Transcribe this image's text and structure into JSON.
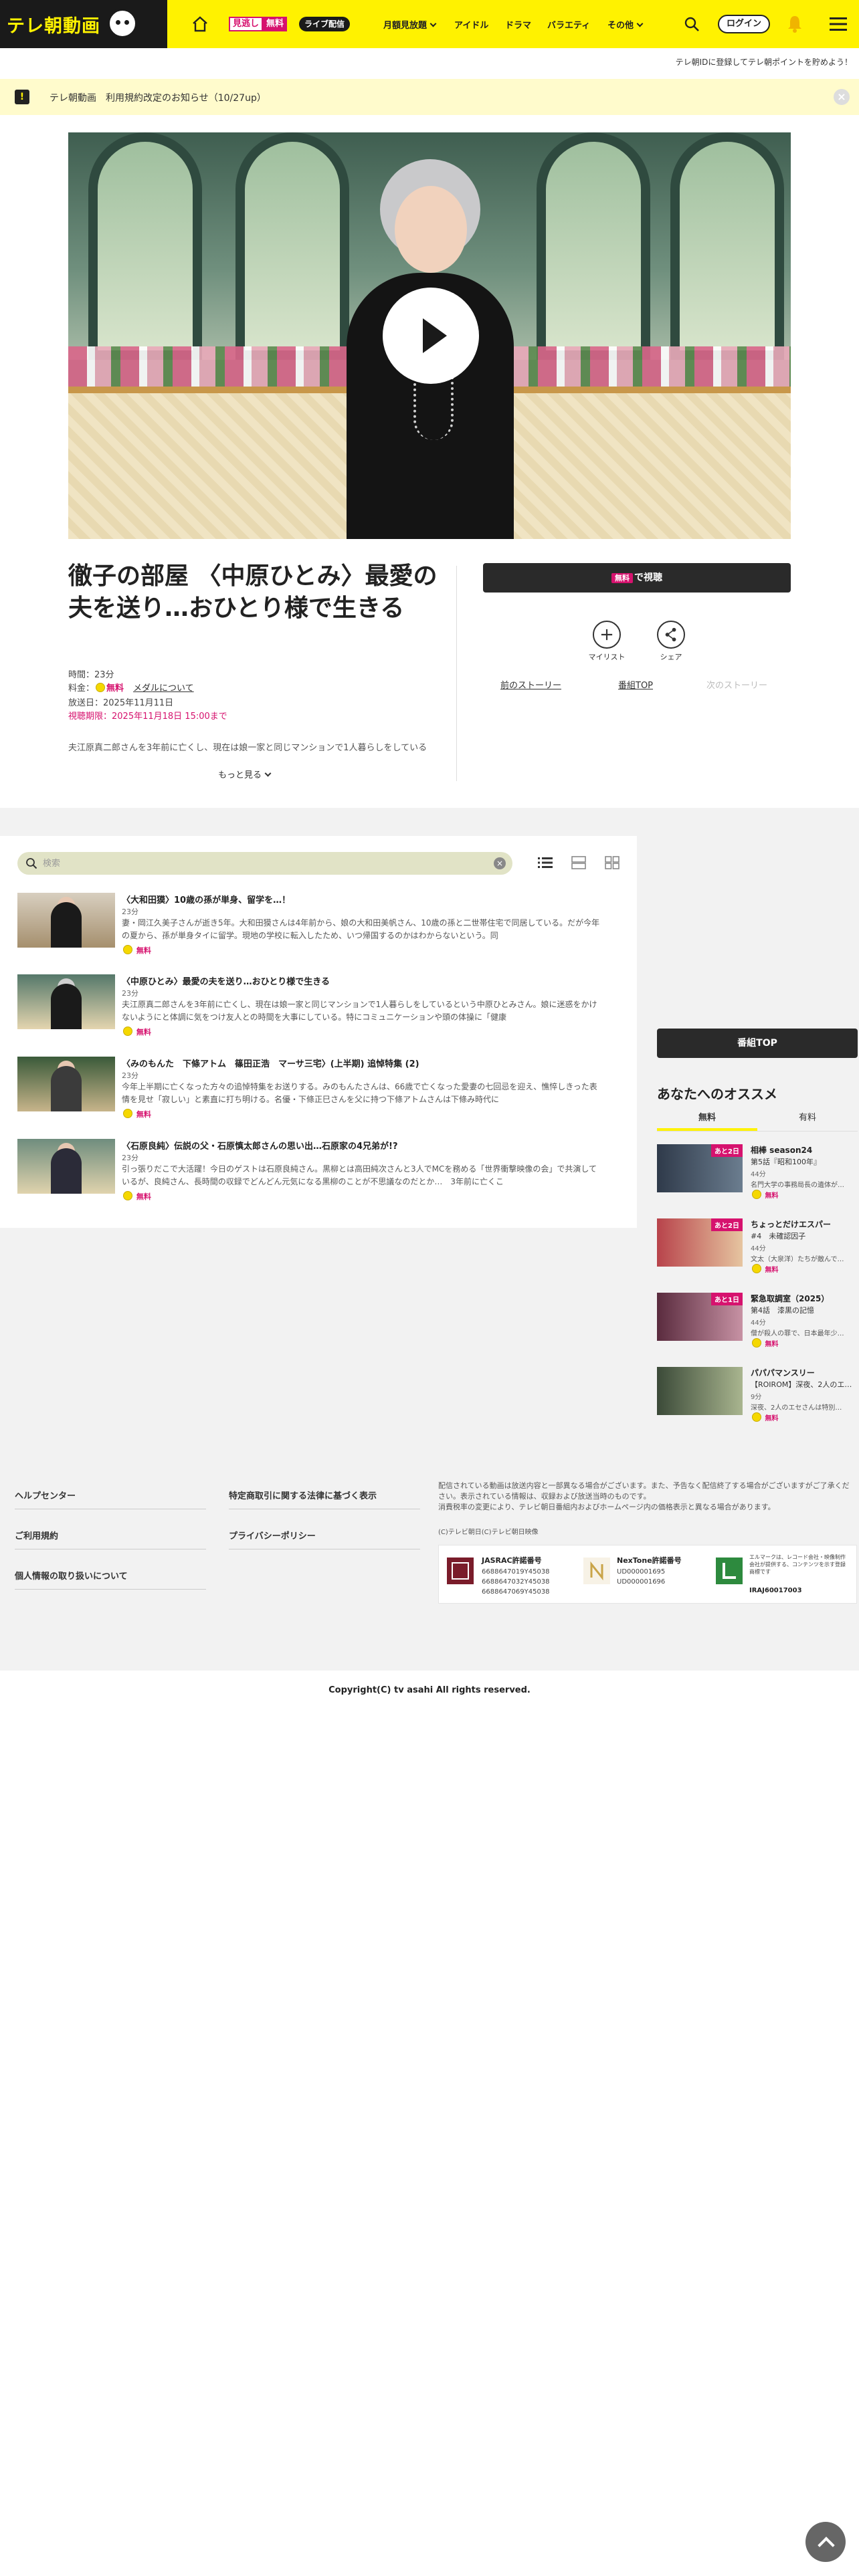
{
  "header": {
    "logo": "テレ朝動画",
    "badge_mitsu": "見逃し",
    "badge_mitsu_free": "無料",
    "badge_live": "ライブ配信",
    "nav": [
      "月額見放題",
      "アイドル",
      "ドラマ",
      "バラエティ",
      "その他"
    ],
    "login": "ログイン",
    "promo": "テレ朝IDに登録してテレ朝ポイントを貯めよう！"
  },
  "notice": {
    "text": "テレ朝動画　利用規約改定のお知らせ（10/27up）",
    "close": "×"
  },
  "episode": {
    "title": "徹子の部屋 〈中原ひとみ〉最愛の夫を送り…おひとり様で生きる",
    "duration": "時間：23分",
    "fee_label": "料金：",
    "fee_free": "無料",
    "medal_link": "メダルについて",
    "air_date": "放送日：2025年11月11日",
    "deadline": "視聴期限：2025年11月18日 15:00まで",
    "description": "夫江原真二郎さんを3年前に亡くし、現在は娘一家と同じマンションで1人暮らしをしている",
    "more": "もっと見る"
  },
  "actions": {
    "watch_tag": "無料",
    "watch_label": "で視聴",
    "mylist": "マイリスト",
    "share": "シェア",
    "prev": "前のストーリー",
    "program_top": "番組TOP",
    "next": "次のストーリー"
  },
  "list": {
    "search_placeholder": "検索",
    "clear": "×",
    "items": [
      {
        "title": "〈大和田獏〉10歳の孫が単身、留学を…！",
        "duration": "23分",
        "desc": "妻・岡江久美子さんが逝き5年。大和田獏さんは4年前から、娘の大和田美帆さん、10歳の孫と二世帯住宅で同居している。だが今年の夏から、孫が単身タイに留学。現地の学校に転入したため、いつ帰国するのかはわからないという。同",
        "free": "無料"
      },
      {
        "title": "〈中原ひとみ〉最愛の夫を送り…おひとり様で生きる",
        "duration": "23分",
        "desc": "夫江原真二郎さんを3年前に亡くし、現在は娘一家と同じマンションで1人暮らしをしているという中原ひとみさん。娘に迷惑をかけないようにと体調に気をつけ友人との時間を大事にしている。特にコミュニケーションや頭の体操に「健康",
        "free": "無料"
      },
      {
        "title": "〈みのもんた　下條アトム　篠田正浩　マーサ三宅〉(上半期) 追悼特集 (2)",
        "duration": "23分",
        "desc": "今年上半期に亡くなった方々の追悼特集をお送りする。みのもんたさんは、66歳で亡くなった愛妻の七回忌を迎え、憔悴しきった表情を見せ「寂しい」と素直に打ち明ける。名優・下條正巳さんを父に持つ下條アトムさんは下條み時代に",
        "free": "無料"
      },
      {
        "title": "〈石原良純〉伝説の父・石原慎太郎さんの思い出…石原家の4兄弟が!?",
        "duration": "23分",
        "desc": "引っ張りだこで大活躍！今日のゲストは石原良純さん。黒柳とは高田純次さんと3人でMCを務める「世界衝撃映像の会」で共演しているが、良純さん、長時間の収録でどんどん元気になる黒柳のことが不思議なのだとか…　3年前に亡くこ",
        "free": "無料"
      }
    ]
  },
  "sidebar": {
    "program_top": "番組TOP",
    "title": "あなたへのオススメ",
    "tabs": [
      "無料",
      "有料"
    ],
    "items": [
      {
        "badge": "あと2日",
        "title": "相棒 season24",
        "sub": "第5話『昭和100年』",
        "dur": "44分",
        "desc": "名門大学の事務局長の遺体が…",
        "free": "無料"
      },
      {
        "badge": "あと2日",
        "title": "ちょっとだけエスパー",
        "sub": "#4　未確認因子",
        "dur": "44分",
        "desc": "文太（大泉洋）たちが敵んで…",
        "free": "無料"
      },
      {
        "badge": "あと1日",
        "title": "緊急取調室（2025）",
        "sub": "第4話　漆黒の記憶",
        "dur": "44分",
        "desc": "僧が殺人の罪で、日本最年少…",
        "free": "無料"
      },
      {
        "badge": "",
        "title": "パパパマンスリー",
        "sub": "【ROIROM】深夜、2人のエ…",
        "dur": "9分",
        "desc": "深夜、2人のエセさんは特別…",
        "free": "無料"
      }
    ]
  },
  "footer": {
    "links_left": [
      "ヘルプセンター",
      "ご利用規約",
      "個人情報の取り扱いについて"
    ],
    "links_mid": [
      "特定商取引に関する法律に基づく表示",
      "プライバシーポリシー"
    ],
    "note": "配信されている動画は放送内容と一部異なる場合がございます。また、予告なく配信終了する場合がございますがご了承ください。表示されている情報は、収録および放送当時のものです。\n消費税率の変更により、テレビ朝日番組内およびホームページ内の価格表示と異なる場合があります。",
    "copy_small": "(C)テレビ朝日(C)テレビ朝日映像",
    "jasrac_title": "JASRAC許諾番号",
    "jasrac_nums": [
      "6688647019Y45038",
      "6688647032Y45038",
      "6688647069Y45038"
    ],
    "nextone_title": "NexTone許諾番号",
    "nextone_nums": [
      "UD000001695",
      "UD000001696"
    ],
    "lmark_text": "エルマークは、レコード会社・映像制作会社が提供する、コンテンツを示す登録商標です",
    "lmark_num": "IRAJ60017003",
    "copyright": "Copyright(C) tv asahi All rights reserved."
  },
  "colors": {
    "brand_yellow": "#fff200",
    "accent_pink": "#d6126e",
    "dark": "#2a2a2a"
  }
}
